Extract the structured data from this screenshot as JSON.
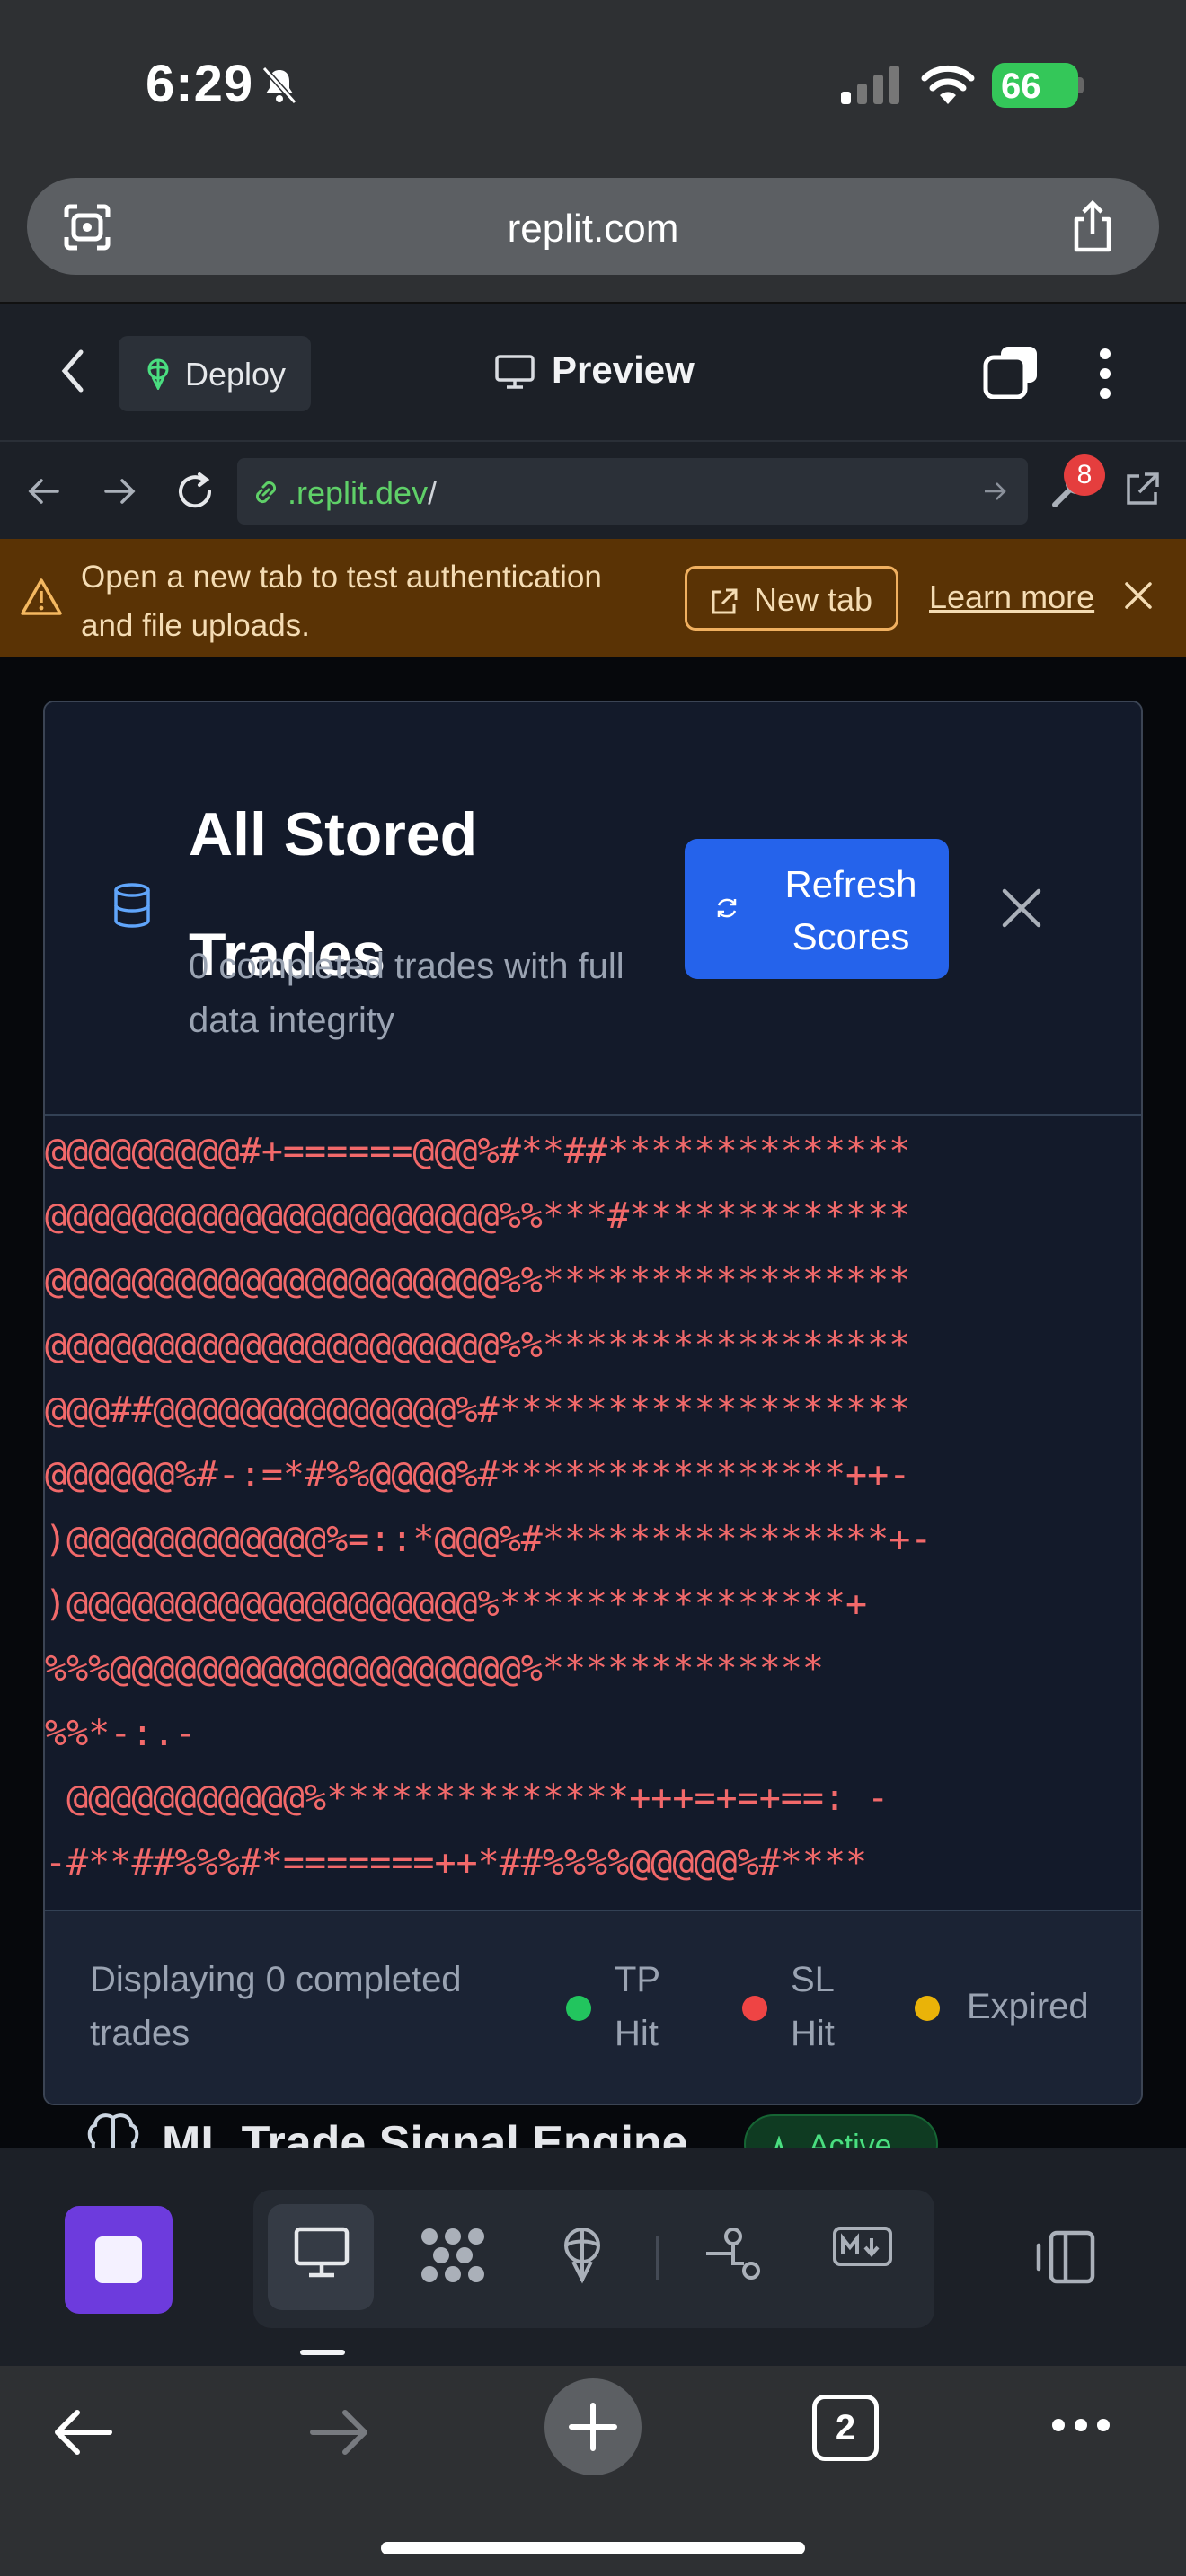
{
  "status_bar": {
    "time": "6:29",
    "battery": "66"
  },
  "browser": {
    "url": "replit.com"
  },
  "replit_toolbar": {
    "deploy_label": "Deploy",
    "preview_label": "Preview"
  },
  "preview_nav": {
    "url_prefix": ".replit.dev",
    "url_suffix": "/",
    "badge_count": "8"
  },
  "banner": {
    "text": "Open a new tab to test authentication and file uploads.",
    "new_tab_label": "New tab",
    "learn_more_label": "Learn more"
  },
  "card": {
    "title": "All Stored Trades",
    "subtitle": "0 completed trades with full data integrity",
    "refresh_label": "Refresh Scores",
    "ascii_lines": [
      "@@@@@@@@@#+======@@@%#**##**************",
      "@@@@@@@@@@@@@@@@@@@@@%%***#*************",
      "@@@@@@@@@@@@@@@@@@@@@%%*****************",
      "@@@@@@@@@@@@@@@@@@@@@%%*****************",
      "@@@##@@@@@@@@@@@@@@%#*******************",
      "@@@@@@%#-:=*#%%@@@@%#****************++-",
      ")@@@@@@@@@@@@%=::*@@@%#****************+-",
      ")@@@@@@@@@@@@@@@@@@@%****************+",
      "%%%@@@@@@@@@@@@@@@@@@@%*************",
      "%%*-:.-",
      " @@@@@@@@@@@%**************+++=+=+==: -",
      "-#**##%%%#*=======++*##%%%%@@@@@%#****"
    ],
    "footer_text": "Displaying 0 completed trades",
    "legend": [
      {
        "label": "TP Hit",
        "color": "#22c55e"
      },
      {
        "label": "SL Hit",
        "color": "#ef4444"
      },
      {
        "label": "Expired",
        "color": "#eab308"
      }
    ]
  },
  "next_section": {
    "title": "ML Trade Signal Engine",
    "badge": "Active"
  },
  "safari": {
    "tab_count": "2"
  }
}
